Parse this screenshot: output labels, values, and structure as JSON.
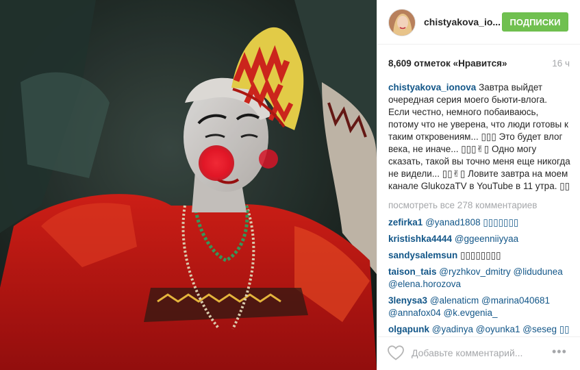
{
  "post": {
    "username": "chistyakova_io...",
    "follow_button": "ПОДПИСКИ",
    "likes": "8,609 отметок «Нравится»",
    "time": "16 ч"
  },
  "caption": {
    "username": "chistyakova_ionova",
    "text": "Завтра выйдет очередная серия моего бьюти-влога. Если честно, немного побаиваюсь, потому что не уверена, что люди готовы к таким откровениям... ▯▯▯ Это будет влог века, не иначе... ▯▯▯✌▯ Одно могу сказать, такой вы точно меня еще никогда не видели... ▯▯✌▯ Ловите завтра на моем канале GlukozaTV в YouTube в 11 утра. ▯▯"
  },
  "view_all": "посмотреть все 278 комментариев",
  "comments": [
    {
      "user": "zefirka1",
      "text": "@yanad1808 ▯▯▯▯▯▯▯"
    },
    {
      "user": "kristishka4444",
      "text": "@ggeenniiyyaa"
    },
    {
      "user": "sandysalemsun",
      "text": "▯▯▯▯▯▯▯▯"
    },
    {
      "user": "taison_tais",
      "text": "@ryzhkov_dmitry @lidudunea @elena.horozova"
    },
    {
      "user": "3lenysa3",
      "text": "@alenaticm @marina040681 @annafox04 @k.evgenia_"
    },
    {
      "user": "olgapunk",
      "text": "@yadinya @oyunka1 @seseg ▯▯"
    },
    {
      "user": "",
      "text": ""
    }
  ],
  "footer": {
    "placeholder": "Добавьте комментарий...",
    "more": "•••"
  },
  "icons": {
    "heart": "heart-icon",
    "more": "more-options-icon"
  },
  "colors": {
    "follow_button": "#70c050",
    "username": "#125688",
    "muted": "#a5a7aa"
  }
}
